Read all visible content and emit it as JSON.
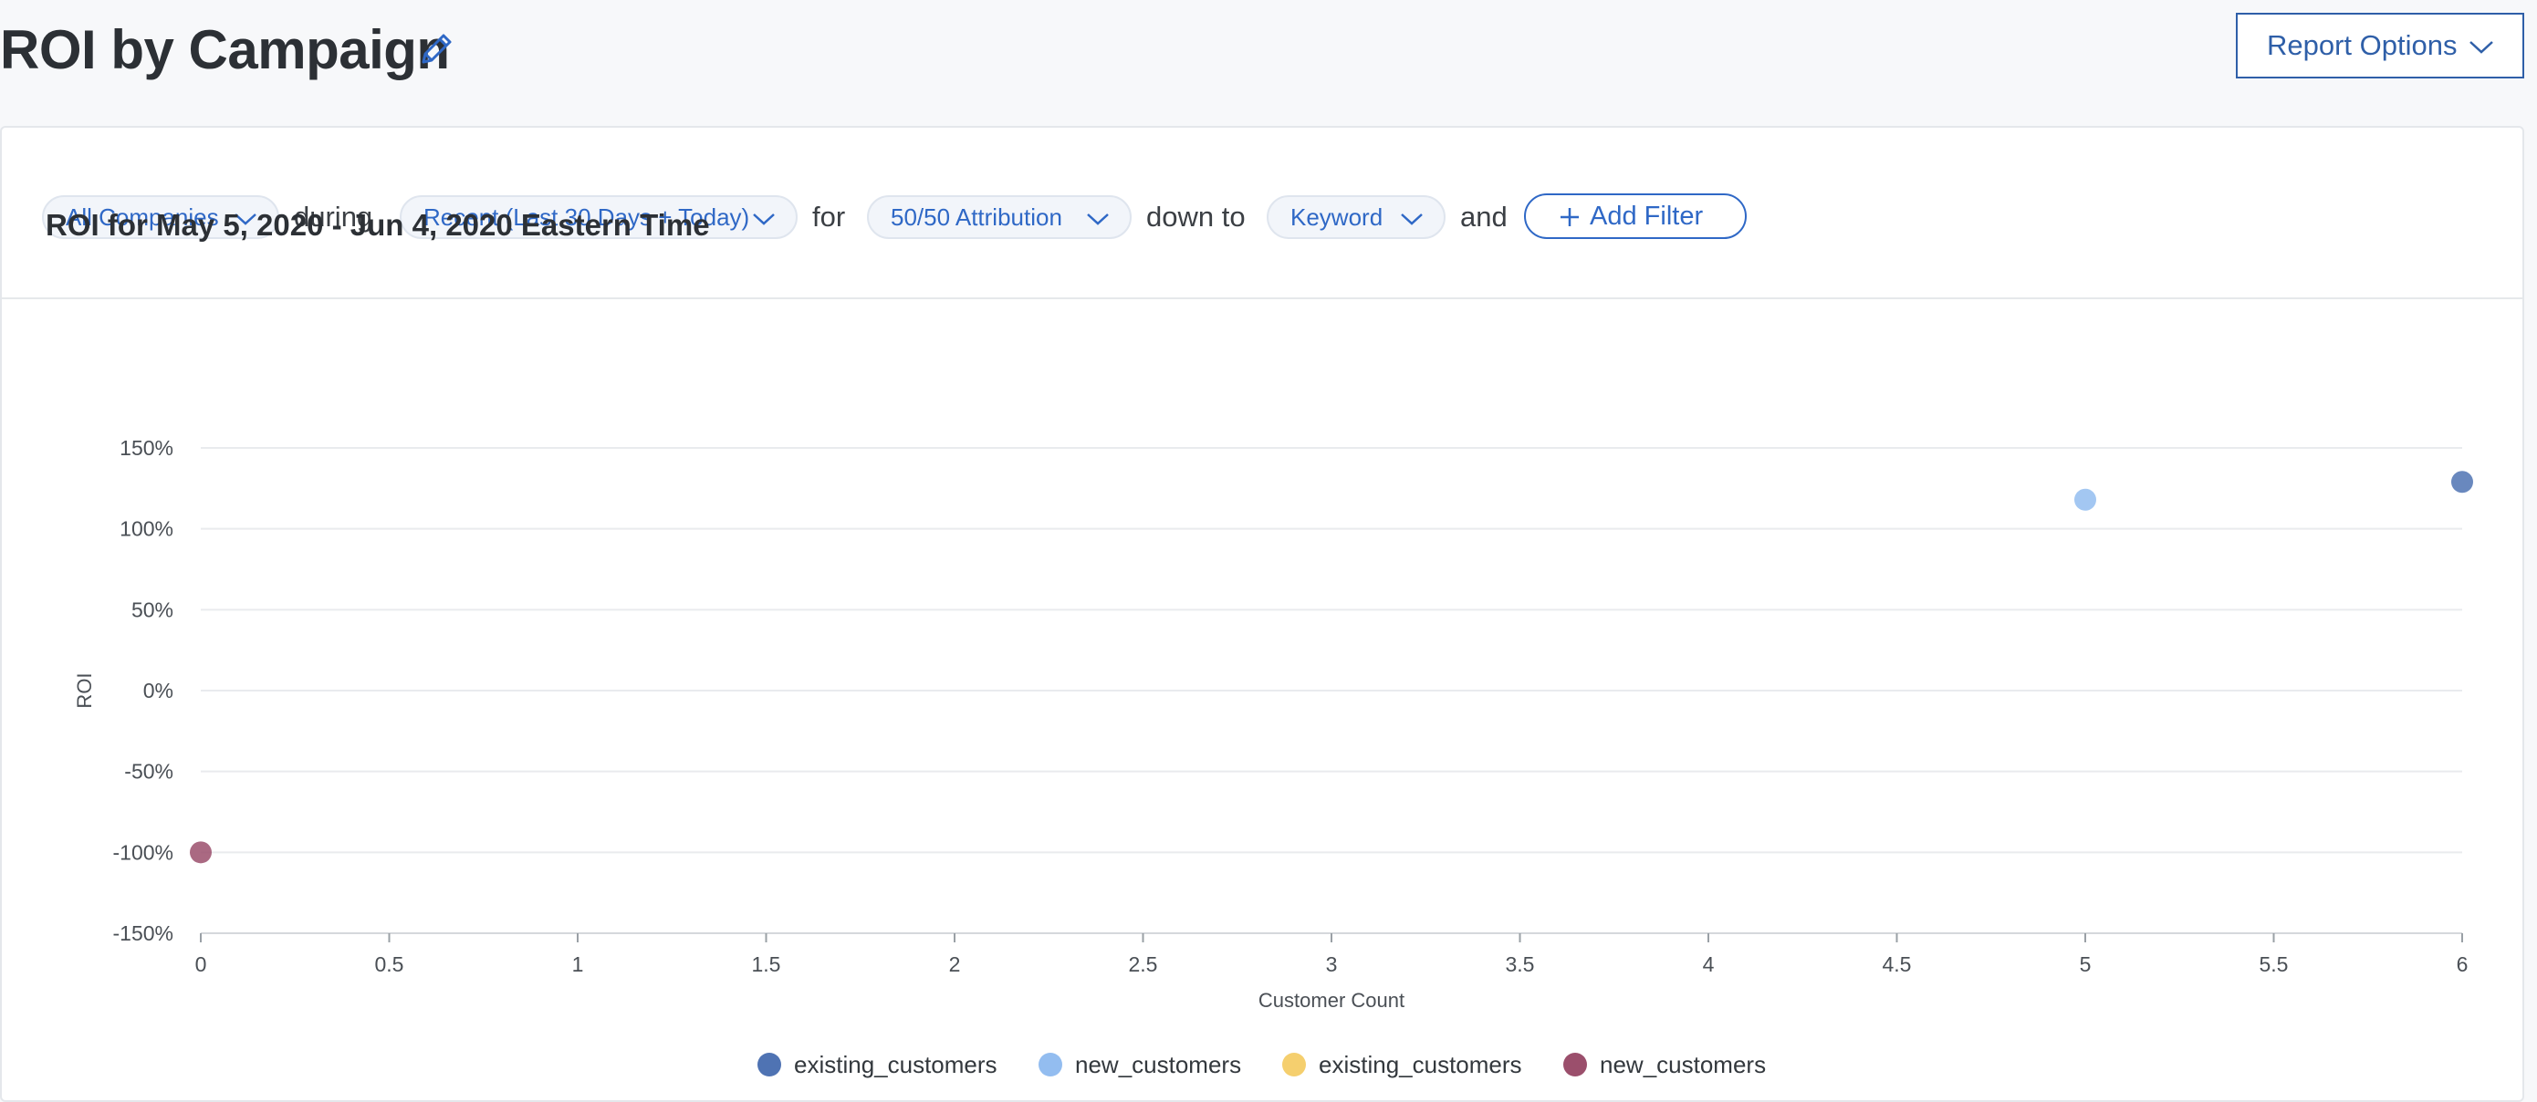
{
  "header": {
    "title": "ROI by Campaign",
    "report_options_label": "Report Options"
  },
  "filters": {
    "company": "All Companies",
    "conn_during": "during",
    "date_range": "Recent (Last 30 Days + Today)",
    "conn_for": "for",
    "attribution": "50/50 Attribution",
    "conn_down_to": "down to",
    "level": "Keyword",
    "conn_and": "and",
    "add_filter_label": "Add Filter"
  },
  "icons": {
    "edit": "pencil-icon",
    "dropdown": "chevron-down-icon",
    "add": "plus-icon"
  },
  "chart_data": {
    "type": "scatter",
    "title": "ROI for May 5, 2020 - Jun 4, 2020 Eastern Time",
    "xlabel": "Customer Count",
    "ylabel": "ROI",
    "xlim": [
      0,
      6
    ],
    "ylim": [
      -150,
      150
    ],
    "x_ticks": [
      "0",
      "0.5",
      "1",
      "1.5",
      "2",
      "2.5",
      "3",
      "3.5",
      "4",
      "4.5",
      "5",
      "5.5",
      "6"
    ],
    "y_ticks": [
      "150%",
      "100%",
      "50%",
      "0%",
      "-50%",
      "-100%",
      "-150%"
    ],
    "grid": true,
    "legend_position": "bottom",
    "series": [
      {
        "name": "existing_customers",
        "color": "#4f73b3",
        "points": [
          {
            "x": 6,
            "y": 129
          }
        ]
      },
      {
        "name": "new_customers",
        "color": "#93bdf0",
        "points": [
          {
            "x": 5,
            "y": 118
          }
        ]
      },
      {
        "name": "existing_customers",
        "color": "#f5cf6e",
        "points": []
      },
      {
        "name": "new_customers",
        "color": "#9b4f6c",
        "points": [
          {
            "x": 0,
            "y": -100
          }
        ]
      }
    ]
  }
}
